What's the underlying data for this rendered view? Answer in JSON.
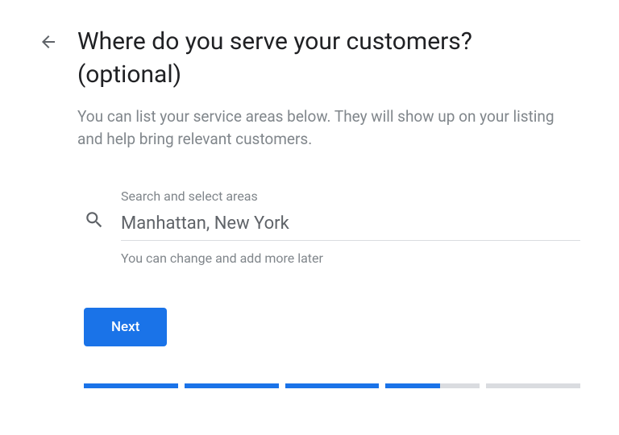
{
  "header": {
    "title": "Where do you serve your customers? (optional)",
    "subtitle": "You can list your service areas below. They will show up on your listing and help bring relevant customers."
  },
  "search": {
    "label": "Search and select areas",
    "value": "Manhattan, New York",
    "hint": "You can change and add more later"
  },
  "actions": {
    "next_label": "Next"
  },
  "progress": {
    "total_segments": 5,
    "completed": 3,
    "partial_index": 3,
    "partial_fraction": 0.58
  },
  "colors": {
    "primary": "#1a73e8",
    "text_primary": "#202124",
    "text_secondary": "#80868b",
    "divider": "#dadce0"
  }
}
